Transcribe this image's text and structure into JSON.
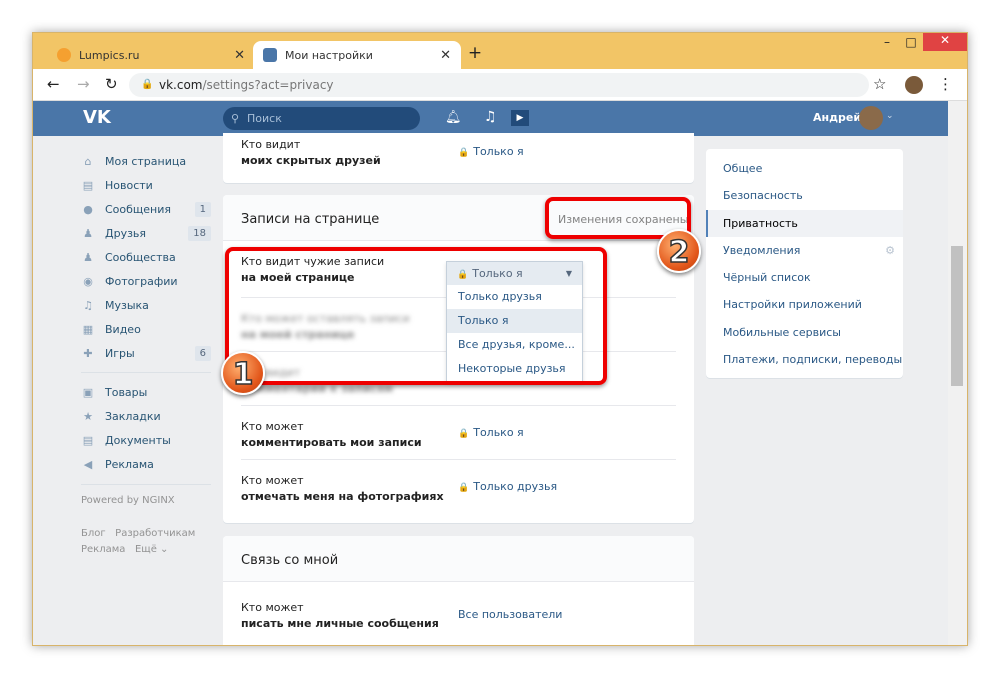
{
  "browser": {
    "tabs": [
      {
        "title": "Lumpics.ru"
      },
      {
        "title": "Мои настройки"
      }
    ],
    "url_host": "vk.com",
    "url_path": "/settings?act=privacy"
  },
  "header": {
    "search_placeholder": "Поиск",
    "user_name": "Андрей"
  },
  "left_nav": {
    "items": [
      {
        "label": "Моя страница",
        "icon": "home-icon"
      },
      {
        "label": "Новости",
        "icon": "news-icon"
      },
      {
        "label": "Сообщения",
        "icon": "message-icon",
        "badge": "1"
      },
      {
        "label": "Друзья",
        "icon": "friends-icon",
        "badge": "18"
      },
      {
        "label": "Сообщества",
        "icon": "groups-icon"
      },
      {
        "label": "Фотографии",
        "icon": "camera-icon"
      },
      {
        "label": "Музыка",
        "icon": "music-icon"
      },
      {
        "label": "Видео",
        "icon": "video-icon"
      },
      {
        "label": "Игры",
        "icon": "gamepad-icon",
        "badge": "6"
      }
    ],
    "items2": [
      {
        "label": "Товары",
        "icon": "bag-icon"
      },
      {
        "label": "Закладки",
        "icon": "star-icon"
      },
      {
        "label": "Документы",
        "icon": "document-icon"
      },
      {
        "label": "Реклама",
        "icon": "megaphone-icon"
      }
    ],
    "powered": "Powered by NGINX",
    "footer": [
      "Блог",
      "Разработчикам",
      "Реклама",
      "Ещё"
    ]
  },
  "main": {
    "top_row": {
      "q1": "Кто видит",
      "q2": "моих скрытых друзей",
      "value": "Только я"
    },
    "section1": {
      "title": "Записи на странице",
      "status": "Изменения сохранены",
      "rows": [
        {
          "q1": "Кто видит чужие записи",
          "q2": "на моей странице",
          "value": "Только я"
        },
        {
          "q1": "Кто может оставлять записи",
          "q2": "на моей странице"
        },
        {
          "q1": "Кто видит",
          "q2": "комментарии к записям"
        },
        {
          "q1": "Кто может",
          "q2": "комментировать мои записи",
          "value": "Только я"
        },
        {
          "q1": "Кто может",
          "q2": "отмечать меня на фотографиях",
          "value": "Только друзья"
        }
      ]
    },
    "dropdown": {
      "selected": "Только я",
      "options": [
        "Только друзья",
        "Только я",
        "Все друзья, кроме...",
        "Некоторые друзья"
      ]
    },
    "section2": {
      "title": "Связь со мной",
      "rows": [
        {
          "q1": "Кто может",
          "q2": "писать мне личные сообщения",
          "value": "Все пользователи"
        }
      ]
    }
  },
  "right_menu": {
    "items": [
      "Общее",
      "Безопасность",
      "Приватность",
      "Уведомления",
      "Чёрный список",
      "Настройки приложений",
      "Мобильные сервисы",
      "Платежи, подписки, переводы"
    ]
  },
  "callouts": [
    "1",
    "2"
  ]
}
